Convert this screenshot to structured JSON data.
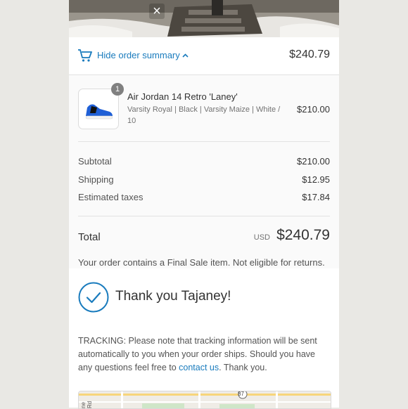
{
  "header": {
    "close_glyph": "×"
  },
  "summary_bar": {
    "toggle_label": "Hide order summary",
    "chevron": "⌃",
    "total": "$240.79"
  },
  "line_items": [
    {
      "quantity": "1",
      "name": "Air Jordan 14 Retro 'Laney'",
      "variant": "Varsity Royal | Black | Varsity Maize | White / 10",
      "price": "$210.00"
    }
  ],
  "costs": {
    "subtotal_label": "Subtotal",
    "subtotal_value": "$210.00",
    "shipping_label": "Shipping",
    "shipping_value": "$12.95",
    "taxes_label": "Estimated taxes",
    "taxes_value": "$17.84"
  },
  "total": {
    "label": "Total",
    "currency": "USD",
    "amount": "$240.79"
  },
  "notice": "Your order contains a Final Sale item. Not eligible for returns.",
  "confirmation": {
    "thank_you": "Thank you Tajaney!",
    "tracking_prefix": "TRACKING",
    "tracking_text": ": Please note that tracking information will be sent automatically to you when your order ships. Should you have any questions feel free to ",
    "contact_link": "contact us",
    "tracking_suffix": ". Thank you."
  },
  "map": {
    "route_label": "87",
    "street_fragment": "ne Rd"
  },
  "colors": {
    "accent": "#197bbd",
    "text": "#333333",
    "muted": "#737373"
  }
}
